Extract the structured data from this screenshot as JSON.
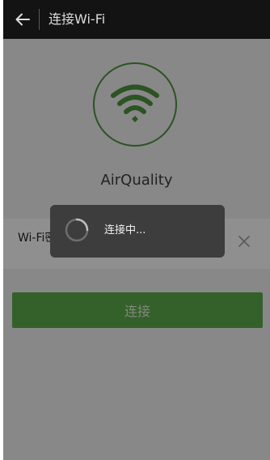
{
  "header": {
    "title": "连接Wi-Fi",
    "back_icon": "back-arrow-icon"
  },
  "device": {
    "name": "AirQuality",
    "icon": "wifi-icon",
    "accent_color": "#4d8f3e"
  },
  "password_field": {
    "label": "Wi-Fi密码",
    "value": "........",
    "clear_icon": "close-icon"
  },
  "connect_button": {
    "label": "连接",
    "color": "#5aa549"
  },
  "loading_dialog": {
    "text": "连接中...",
    "icon": "spinner-icon"
  }
}
